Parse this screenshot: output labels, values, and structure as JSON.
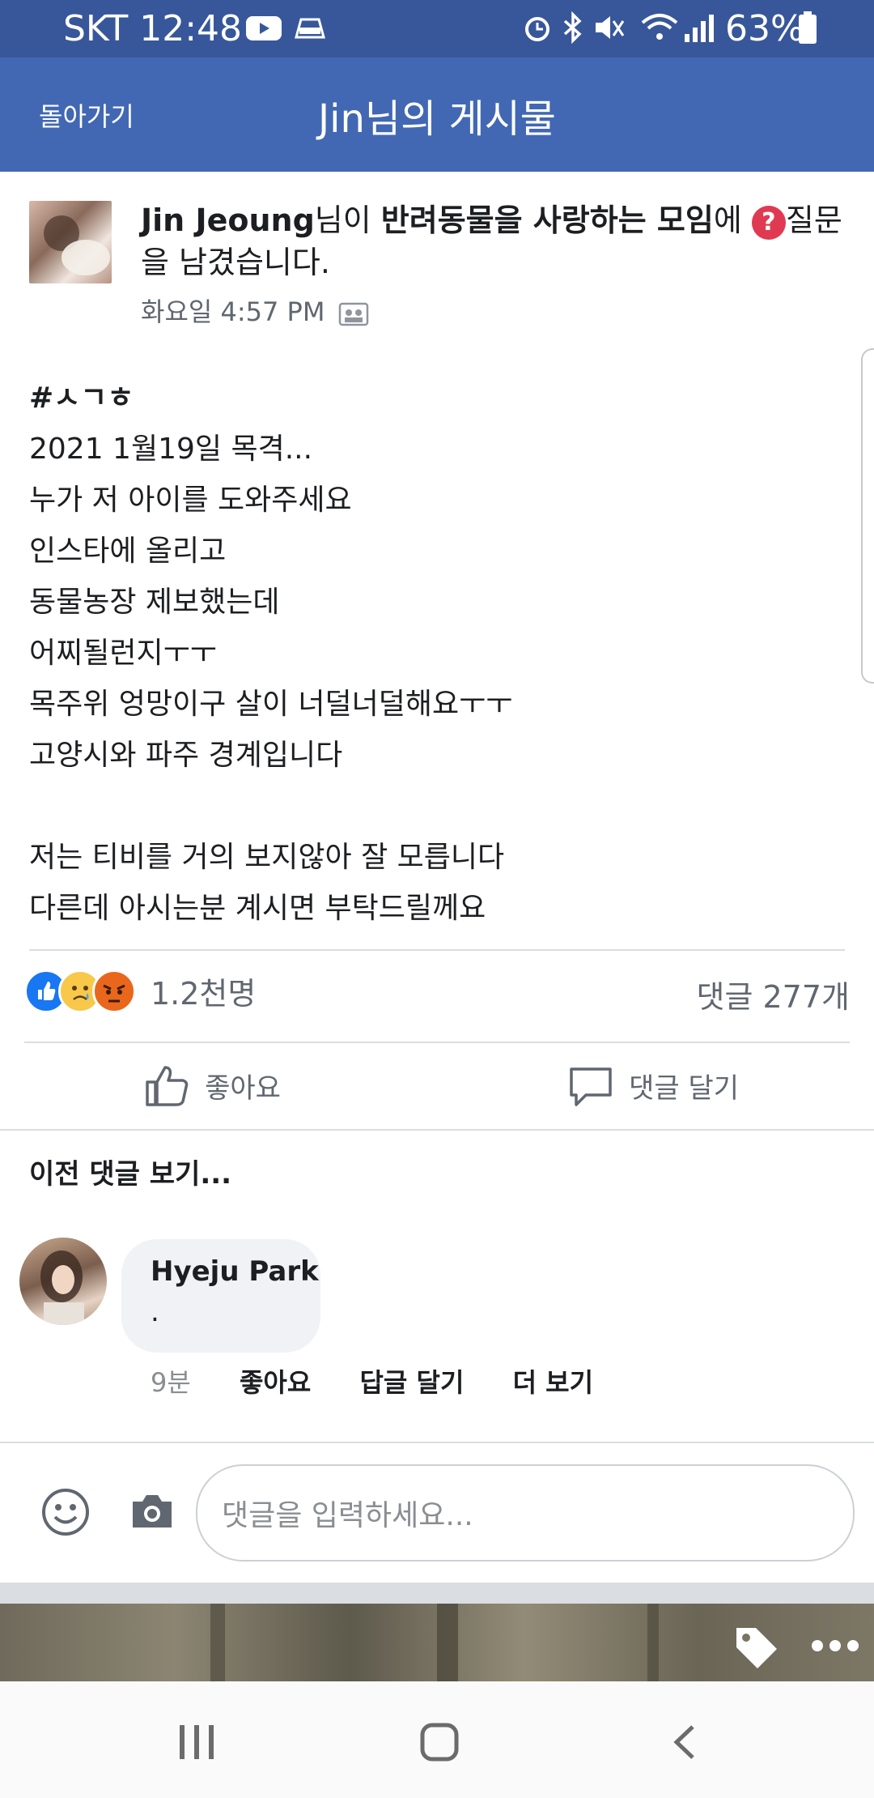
{
  "status_bar": {
    "carrier_time": "SKT 12:48",
    "battery": "63%"
  },
  "header": {
    "back_label": "돌아가기",
    "title": "Jin님의 게시물"
  },
  "post": {
    "author": "Jin Jeoung",
    "head_mid": "님이 ",
    "group": "반려동물을 사랑하는 모임",
    "head_end": "에 ",
    "head_tail": "질문을 남겼습니다.",
    "time": "화요일 4:57 PM",
    "body_lines": [
      "#ㅅㄱㅎ",
      "2021 1월19일 목격...",
      "누가 저 아이를 도와주세요",
      "인스타에 올리고",
      "동물농장 제보했는데",
      "어찌될런지ㅜㅜ",
      "목주위 엉망이구 살이 너덜너덜해요ㅜㅜ",
      "고양시와 파주 경계입니다",
      "",
      "저는 티비를 거의 보지않아 잘 모릅니다",
      "다른데 아시는분 계시면 부탁드릴께요"
    ],
    "reaction_count": "1.2천명",
    "comment_count": "댓글 277개"
  },
  "actions": {
    "like": "좋아요",
    "comment": "댓글 달기"
  },
  "comments": {
    "prev_label": "이전 댓글 보기...",
    "items": [
      {
        "name": "Hyeju Park",
        "text": ".",
        "time": "9분",
        "like": "좋아요",
        "reply": "답글 달기",
        "more": "더 보기"
      }
    ]
  },
  "composer": {
    "placeholder": "댓글을 입력하세요..."
  },
  "colors": {
    "header": "#4268b3",
    "status_bar": "#38579a",
    "like_blue": "#1877f2"
  }
}
